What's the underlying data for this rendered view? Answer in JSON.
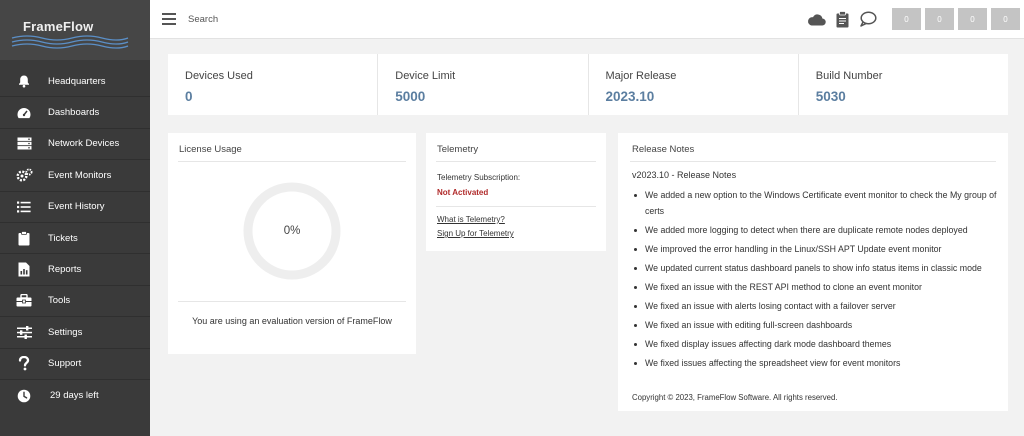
{
  "app": {
    "brand": "FrameFlow"
  },
  "sidebar": {
    "items": [
      {
        "label": "Headquarters",
        "icon": "bell-icon"
      },
      {
        "label": "Dashboards",
        "icon": "gauge-icon"
      },
      {
        "label": "Network Devices",
        "icon": "server-icon"
      },
      {
        "label": "Event Monitors",
        "icon": "gears-icon"
      },
      {
        "label": "Event History",
        "icon": "list-icon"
      },
      {
        "label": "Tickets",
        "icon": "clipboard-icon"
      },
      {
        "label": "Reports",
        "icon": "report-icon"
      },
      {
        "label": "Tools",
        "icon": "toolbox-icon"
      },
      {
        "label": "Settings",
        "icon": "sliders-icon"
      },
      {
        "label": "Support",
        "icon": "question-icon"
      }
    ],
    "trial": {
      "label": "29 days left",
      "icon": "clock-icon"
    }
  },
  "topbar": {
    "search_placeholder": "Search",
    "icons": [
      "cloud-icon",
      "clipboard-icon",
      "chat-icon"
    ],
    "counters": [
      "0",
      "0",
      "0",
      "0"
    ]
  },
  "stats": [
    {
      "label": "Devices Used",
      "value": "0"
    },
    {
      "label": "Device Limit",
      "value": "5000"
    },
    {
      "label": "Major Release",
      "value": "2023.10"
    },
    {
      "label": "Build Number",
      "value": "5030"
    }
  ],
  "license": {
    "title": "License Usage",
    "percent_text": "0%",
    "usage_fraction": 0,
    "message": "You are using an evaluation version of FrameFlow"
  },
  "telemetry": {
    "title": "Telemetry",
    "subscription_label": "Telemetry Subscription:",
    "status": "Not Activated",
    "link_what": "What is Telemetry?",
    "link_signup": "Sign Up for Telemetry"
  },
  "release_notes": {
    "title": "Release Notes",
    "version_heading": "v2023.10 - Release Notes",
    "items": [
      "We added a new option to the Windows Certificate event monitor to check the My group of certs",
      "We added more logging to detect when there are duplicate remote nodes deployed",
      "We improved the error handling in the Linux/SSH APT Update event monitor",
      "We updated current status dashboard panels to show info status items in classic mode",
      "We fixed an issue with the REST API method to clone an event monitor",
      "We fixed an issue with alerts losing contact with a failover server",
      "We fixed an issue with editing full-screen dashboards",
      "We fixed display issues affecting dark mode dashboard themes",
      "We fixed issues affecting the spreadsheet view for event monitors"
    ],
    "copyright": "Copyright © 2023, FrameFlow Software. All rights reserved."
  },
  "colors": {
    "sidebar_bg": "#3a3a3a",
    "stat_value": "#5b7ea0",
    "status_red": "#b02a2a",
    "counter_bg": "#c4c4c4",
    "ring": "#eeeeee",
    "brand_wave": "#5b8fc7"
  }
}
